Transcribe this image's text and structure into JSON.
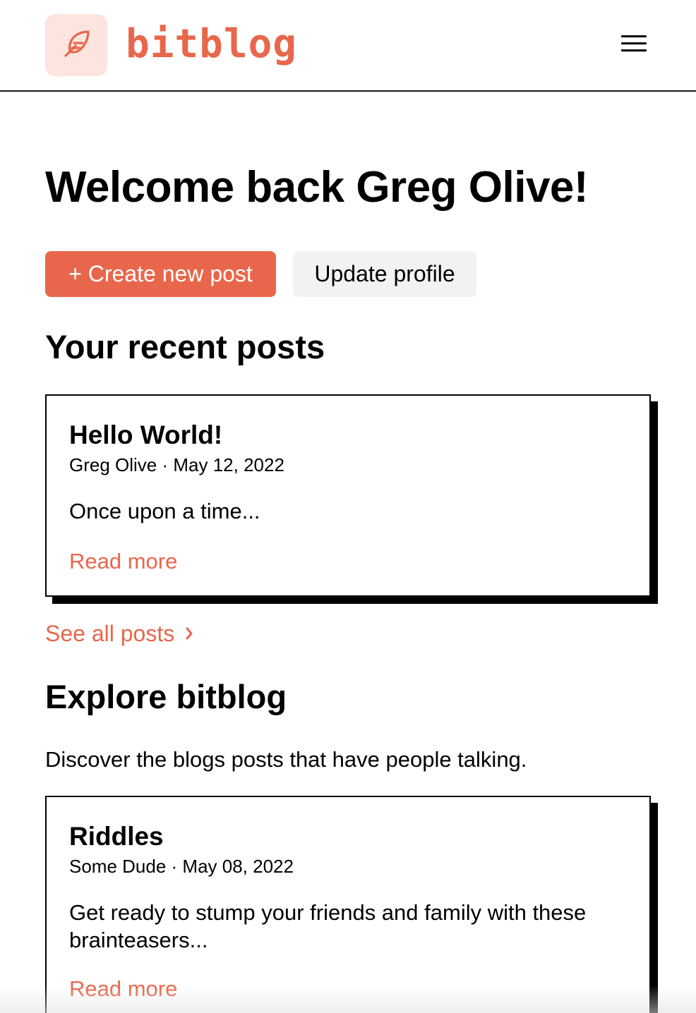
{
  "header": {
    "brand": "bitblog",
    "logo_icon": "feather-icon",
    "menu_icon": "hamburger-menu-icon"
  },
  "welcome": {
    "heading": "Welcome back Greg Olive!"
  },
  "actions": {
    "create_post": "+ Create new post",
    "update_profile": "Update profile"
  },
  "recent": {
    "title": "Your recent posts",
    "posts": [
      {
        "title": "Hello World!",
        "meta": "Greg Olive · May 12, 2022",
        "excerpt": "Once upon a time...",
        "link": "Read more"
      }
    ],
    "see_all": "See all posts"
  },
  "explore": {
    "title": "Explore bitblog",
    "description": "Discover the blogs posts that have people talking.",
    "posts": [
      {
        "title": "Riddles",
        "meta": "Some Dude · May 08, 2022",
        "excerpt": "Get ready to stump your friends and family with these brainteasers...",
        "link": "Read more"
      }
    ]
  },
  "colors": {
    "accent": "#e8674c",
    "logo_bg": "#fde4df",
    "secondary_button_bg": "#f2f2f2",
    "text": "#000000"
  }
}
